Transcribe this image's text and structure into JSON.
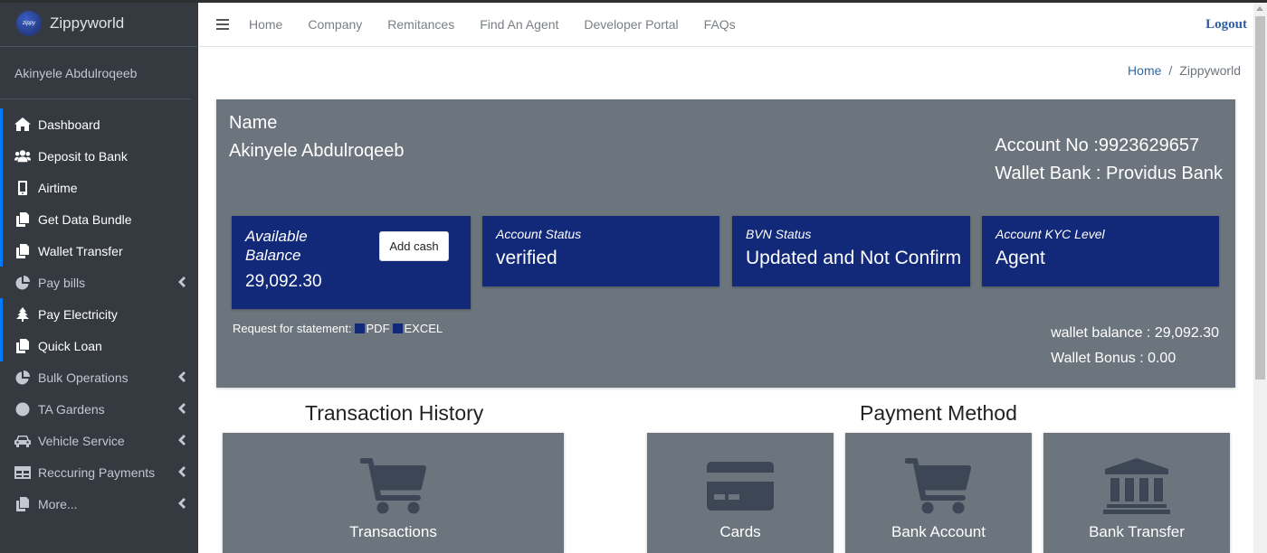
{
  "brand": {
    "logo_text": "zippy",
    "name": "Zippyworld"
  },
  "user": {
    "name": "Akinyele Abdulroqeeb"
  },
  "sidebar": {
    "items": [
      {
        "label": "Dashboard",
        "icon": "home-icon"
      },
      {
        "label": "Deposit to Bank",
        "icon": "users-icon"
      },
      {
        "label": "Airtime",
        "icon": "mobile-icon"
      },
      {
        "label": "Get Data Bundle",
        "icon": "copy-icon"
      },
      {
        "label": "Wallet Transfer",
        "icon": "copy-icon"
      },
      {
        "label": "Pay bills",
        "icon": "pie-chart-icon"
      },
      {
        "label": "Pay Electricity",
        "icon": "tree-icon"
      },
      {
        "label": "Quick Loan",
        "icon": "copy-icon"
      },
      {
        "label": "Bulk Operations",
        "icon": "pie-chart-icon"
      },
      {
        "label": "TA Gardens",
        "icon": "circle-icon"
      },
      {
        "label": "Vehicle Service",
        "icon": "car-icon"
      },
      {
        "label": "Reccuring Payments",
        "icon": "table-icon"
      },
      {
        "label": "More...",
        "icon": "copy-icon"
      }
    ]
  },
  "topnav": {
    "links": [
      "Home",
      "Company",
      "Remitances",
      "Find An Agent",
      "Developer Portal",
      "FAQs"
    ],
    "logout": "Logout"
  },
  "breadcrumb": {
    "home": "Home",
    "sep": "/",
    "current": "Zippyworld"
  },
  "account": {
    "name_label": "Name",
    "name_value": "Akinyele Abdulroqeeb",
    "account_no": "Account No :9923629657",
    "wallet_bank": "Wallet Bank : Providus Bank"
  },
  "stats": {
    "balance_label": "Available Balance",
    "balance_value": "29,092.30",
    "add_cash": "Add cash",
    "status_label": "Account Status",
    "status_value": "verified",
    "bvn_label": "BVN Status",
    "bvn_value": "Updated and Not Confirm",
    "kyc_label": "Account KYC Level",
    "kyc_value": "Agent"
  },
  "statement": {
    "label": "Request for statement:",
    "pdf": "PDF",
    "excel": "EXCEL"
  },
  "wallet": {
    "balance": "wallet balance : 29,092.30",
    "bonus": "Wallet Bonus : 0.00"
  },
  "sections": {
    "transactions_title": "Transaction History",
    "payment_title": "Payment Method"
  },
  "tiles": {
    "transactions": "Transactions",
    "cards": "Cards",
    "bank_account": "Bank Account",
    "bank_transfer": "Bank Transfer"
  },
  "colors": {
    "sidebar": "#343a40",
    "card_gray": "#6c757d",
    "stat_blue": "#12297a",
    "active_accent": "#007bff"
  }
}
